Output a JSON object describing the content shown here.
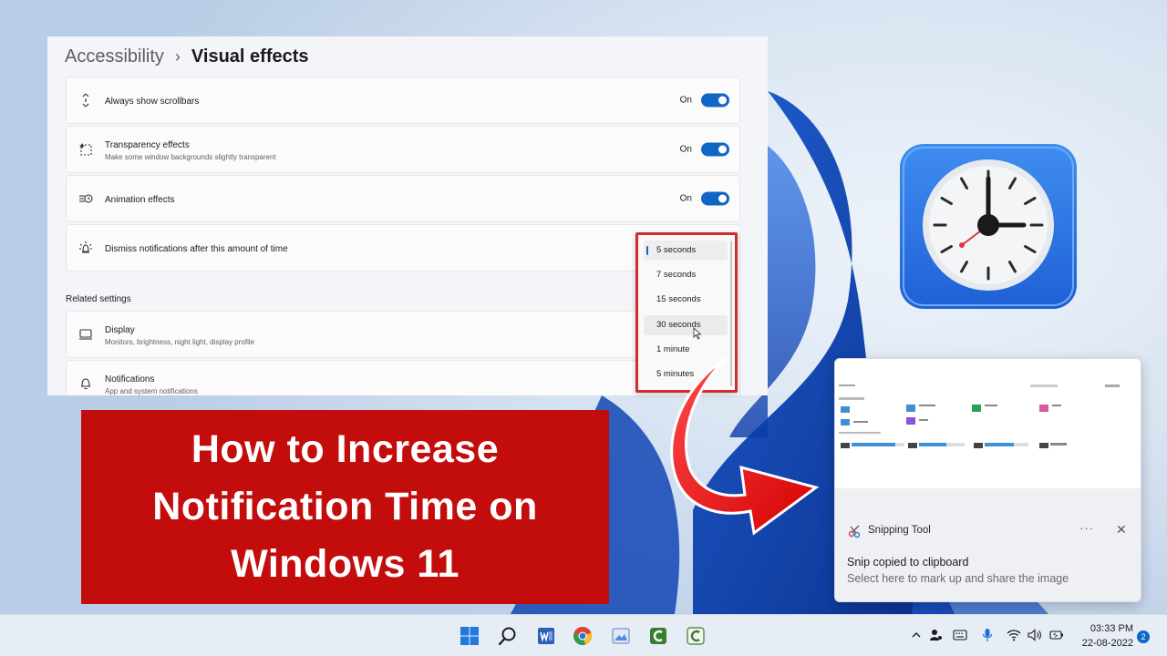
{
  "settings": {
    "breadcrumb": {
      "parent": "Accessibility",
      "separator": "›",
      "current": "Visual effects"
    },
    "items": [
      {
        "title": "Always show scrollbars",
        "subtitle": "",
        "state": "On",
        "icon": "scrollbar-icon"
      },
      {
        "title": "Transparency effects",
        "subtitle": "Make some window backgrounds slightly transparent",
        "state": "On",
        "icon": "transparency-icon"
      },
      {
        "title": "Animation effects",
        "subtitle": "",
        "state": "On",
        "icon": "animation-icon"
      },
      {
        "title": "Dismiss notifications after this amount of time",
        "subtitle": "",
        "icon": "notification-timer-icon"
      }
    ],
    "related_label": "Related settings",
    "related": [
      {
        "title": "Display",
        "subtitle": "Monitors, brightness, night light, display profile",
        "icon": "display-icon"
      },
      {
        "title": "Notifications",
        "subtitle": "App and system notifications",
        "icon": "bell-icon"
      }
    ]
  },
  "dropdown": {
    "selected": "5 seconds",
    "options": [
      "5 seconds",
      "7 seconds",
      "15 seconds",
      "30 seconds",
      "1 minute",
      "5 minutes"
    ]
  },
  "banner": {
    "lines": [
      "How to Increase",
      "Notification Time on",
      "Windows 11"
    ],
    "color": "#c30d0d"
  },
  "toast": {
    "app_name": "Snipping Tool",
    "more": "···",
    "close": "✕",
    "title": "Snip copied to clipboard",
    "body": "Select here to mark up and share the image"
  },
  "taskbar": {
    "apps": [
      "windows-start-icon",
      "search-icon",
      "word-icon",
      "chrome-icon",
      "photos-icon",
      "camtasia-icon",
      "camtasia-alt-icon"
    ],
    "tray": [
      "chevron-up-icon",
      "network-person-icon",
      "keyboard-icon",
      "microphone-icon",
      "wifi-icon",
      "volume-icon",
      "battery-icon"
    ],
    "time": "03:33 PM",
    "date": "22-08-2022",
    "notification_count": "2"
  },
  "colors": {
    "accent": "#0f66c4",
    "highlight_border": "#d12d2d"
  }
}
